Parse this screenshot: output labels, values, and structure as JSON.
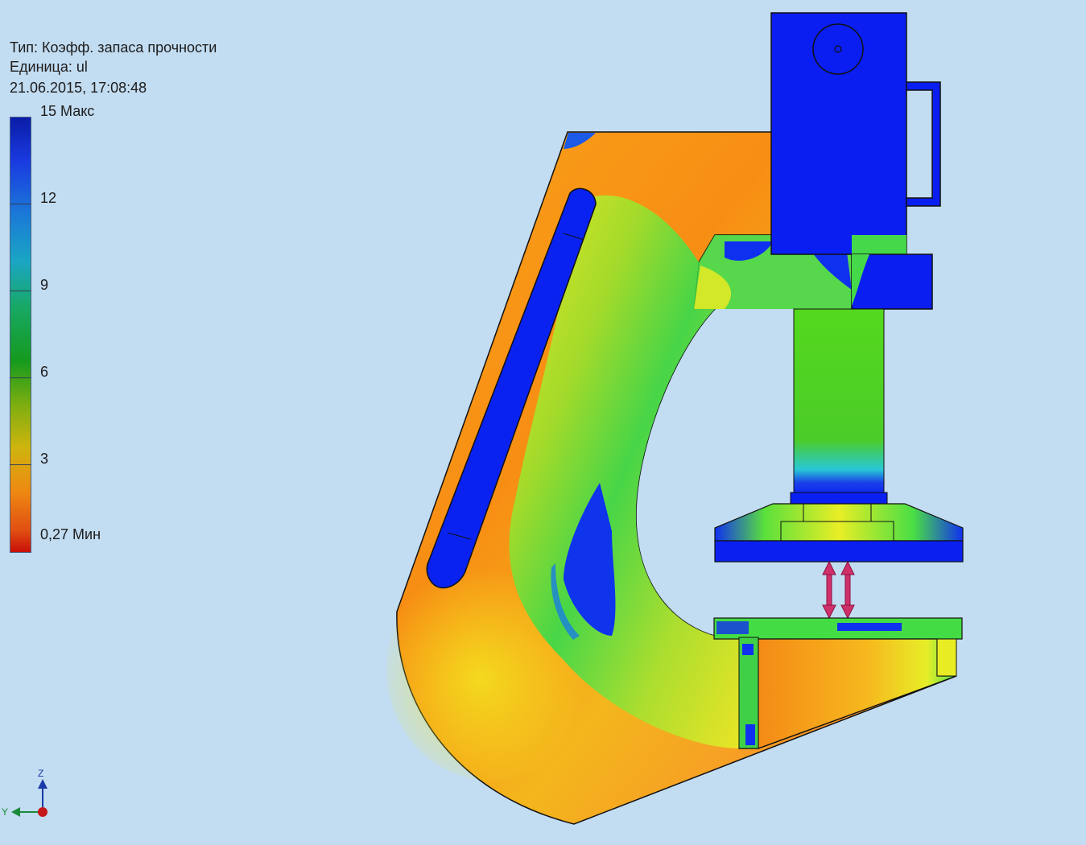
{
  "result_info": {
    "type_line": "Тип: Коэфф. запаса прочности",
    "unit_line": "Единица: ul",
    "timestamp": "21.06.2015, 17:08:48"
  },
  "legend": {
    "max_label": "15 Макс",
    "labels": [
      "12",
      "9",
      "6",
      "3"
    ],
    "min_label": "0,27 Мин",
    "max_value": 15,
    "min_value": 0.27,
    "colors": {
      "high": "#0a1ca8",
      "blue": "#1a3ae0",
      "green": "#159a1e",
      "yellow": "#f0ee10",
      "orange": "#f59818",
      "low": "#c81008"
    }
  },
  "view_triad": {
    "z_label": "Z",
    "y_label": "Y",
    "icon": "coordinate-axes-icon"
  },
  "model": {
    "icon": "press-frame-model",
    "load_arrows": 2
  }
}
